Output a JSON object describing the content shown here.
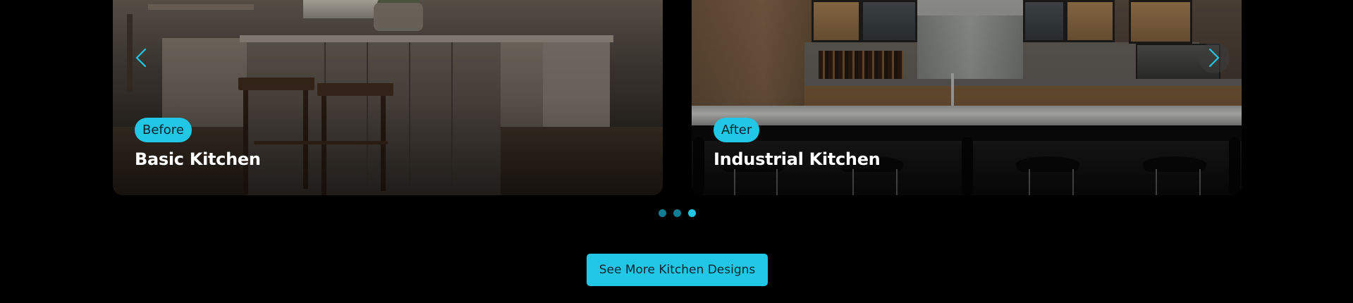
{
  "slides": [
    {
      "badge": "Before",
      "title": "Basic Kitchen",
      "image": "basic-kitchen-photo"
    },
    {
      "badge": "After",
      "title": "Industrial Kitchen",
      "image": "industrial-kitchen-photo"
    }
  ],
  "carousel": {
    "prev_icon": "chevron-left-icon",
    "next_icon": "chevron-right-icon",
    "dots_count": 3,
    "active_dot": 3
  },
  "cta": {
    "label": "See More Kitchen Designs"
  },
  "colors": {
    "accent": "#22c7e6",
    "dot_inactive": "#127e95",
    "background": "#000000",
    "title_text": "#ffffff"
  }
}
